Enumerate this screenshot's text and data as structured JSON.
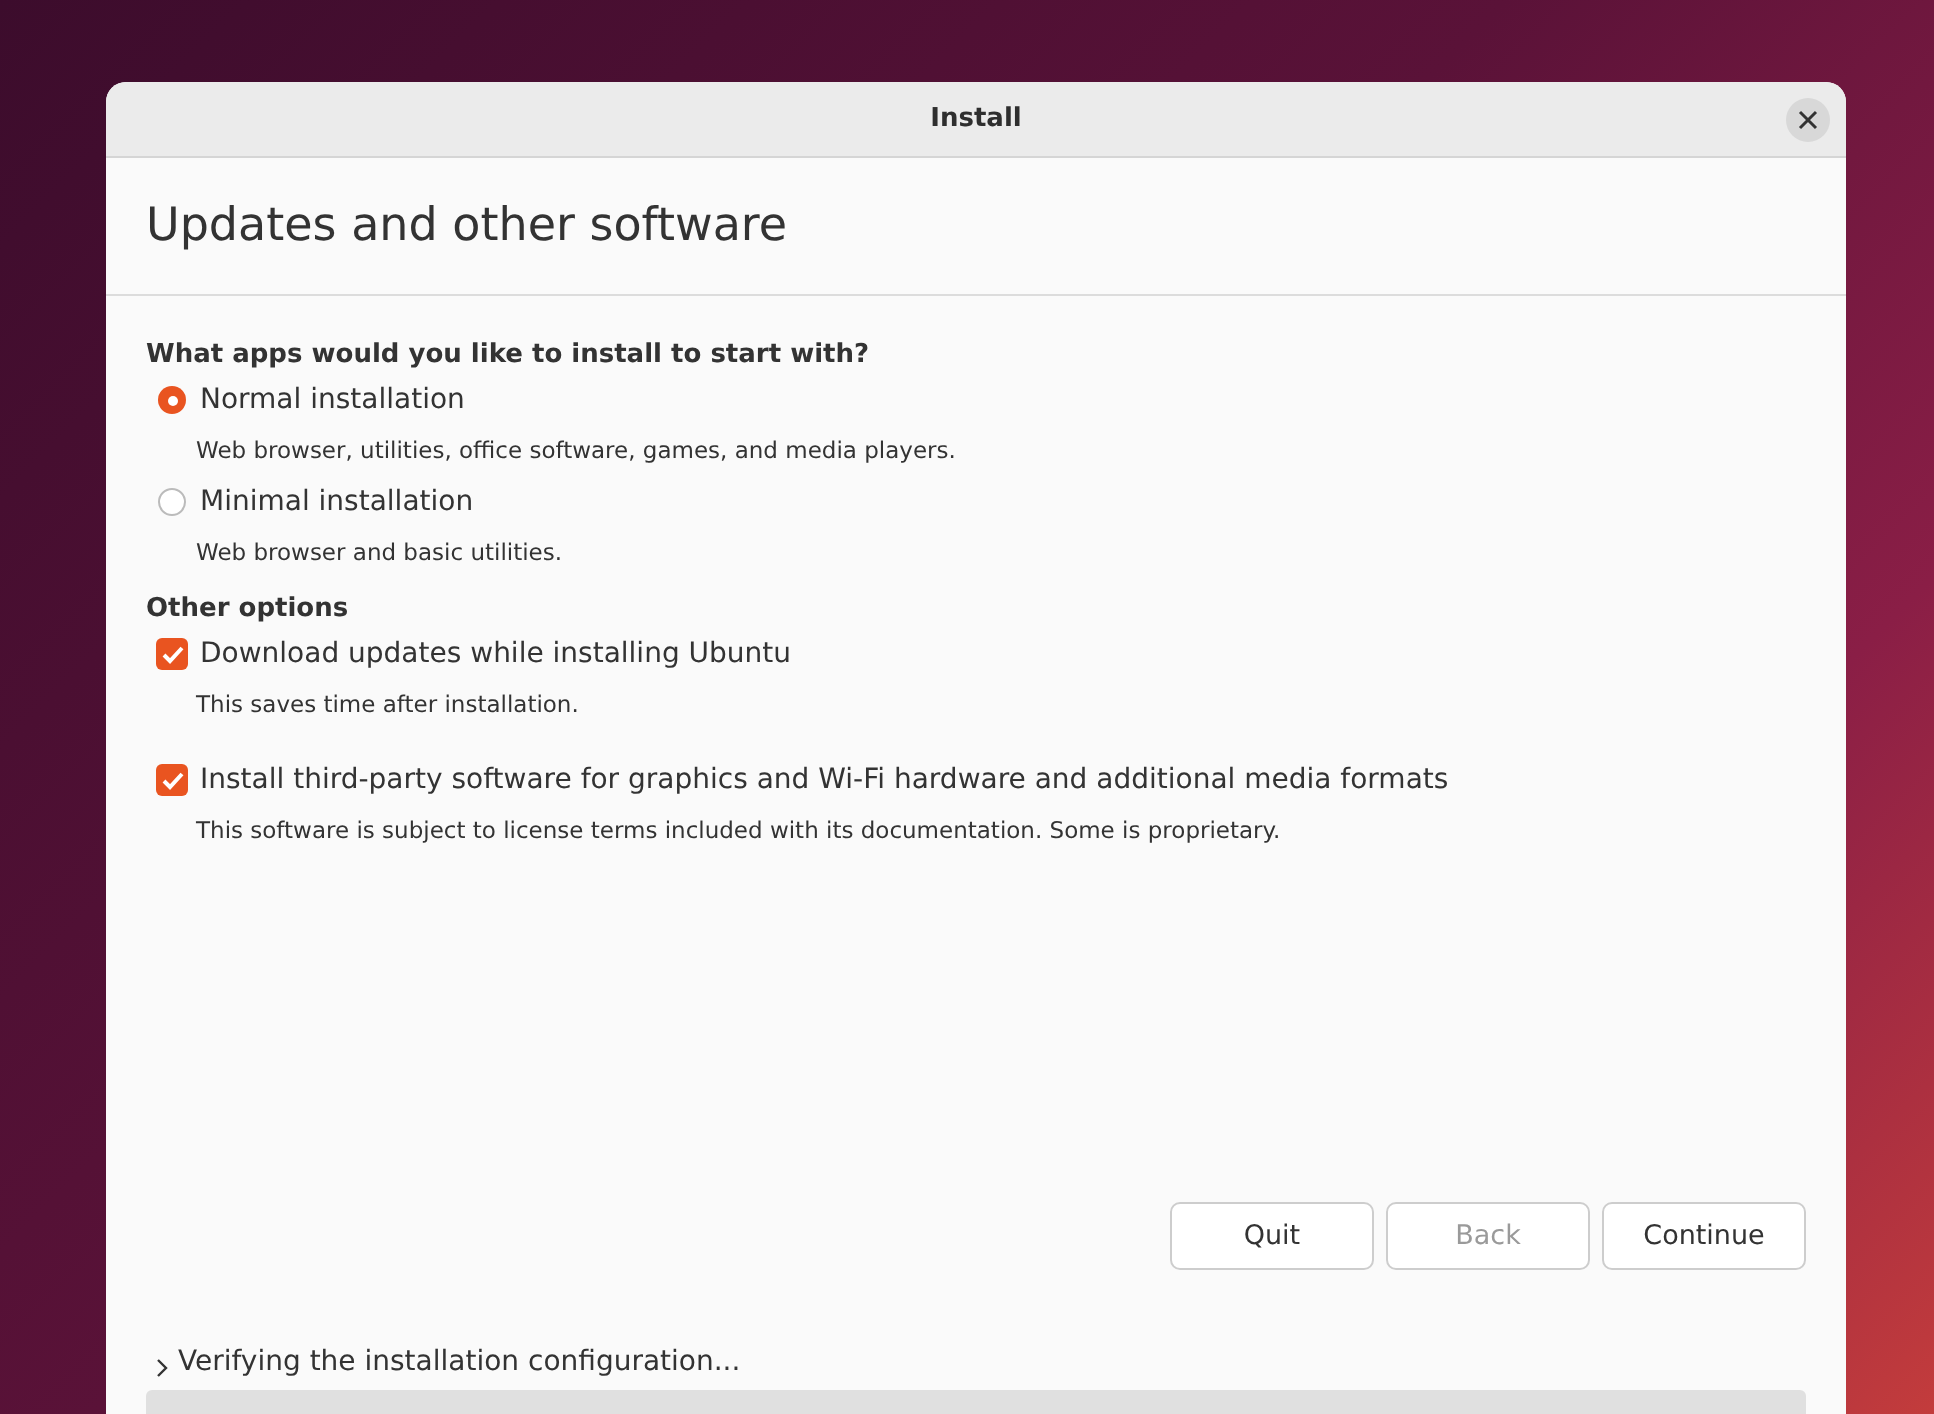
{
  "window": {
    "title": "Install"
  },
  "page_title": "Updates and other software",
  "sections": [
    {
      "heading": "What apps would you like to install to start with?",
      "options": [
        {
          "kind": "radio",
          "label": "Normal installation",
          "description": "Web browser, utilities, office software, games, and media players.",
          "selected": true
        },
        {
          "kind": "radio",
          "label": "Minimal installation",
          "description": "Web browser and basic utilities.",
          "selected": false
        }
      ]
    },
    {
      "heading": "Other options",
      "options": [
        {
          "kind": "checkbox",
          "label": "Download updates while installing Ubuntu",
          "description": "This saves time after installation.",
          "checked": true
        },
        {
          "kind": "checkbox",
          "label": "Install third-party software for graphics and Wi-Fi hardware and additional media formats",
          "description": "This software is subject to license terms included with its documentation. Some is proprietary.",
          "checked": true
        }
      ]
    }
  ],
  "buttons": [
    {
      "label": "Quit",
      "disabled": false
    },
    {
      "label": "Back",
      "disabled": true
    },
    {
      "label": "Continue",
      "disabled": false
    }
  ],
  "status": {
    "text": "Verifying the installation configuration...",
    "expanded": false
  },
  "progress": {
    "level": 0
  }
}
